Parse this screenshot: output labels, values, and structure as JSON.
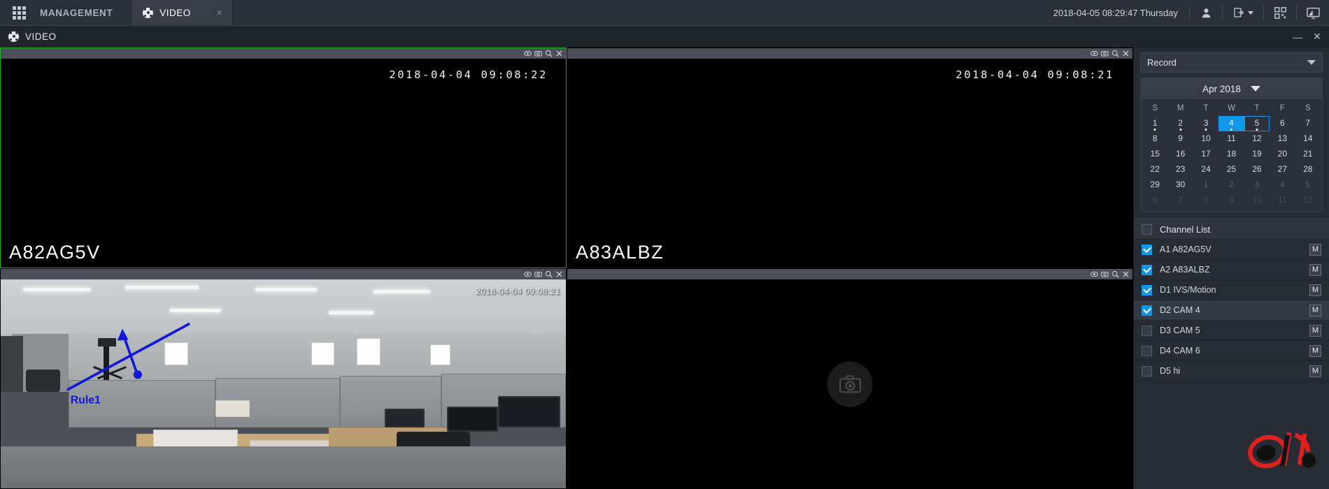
{
  "topbar": {
    "grid_icon": "app-grid-icon",
    "management_tab": "MANAGEMENT",
    "video_tab": "VIDEO",
    "video_tab_icon": "film-reel-icon",
    "close_icon": "×",
    "clock": "2018-04-05 08:29:47 Thursday",
    "icons": [
      {
        "name": "user-icon",
        "glyph": "👤"
      },
      {
        "name": "logout-icon",
        "glyph": "↪"
      },
      {
        "name": "qrcode-icon",
        "glyph": "░"
      },
      {
        "name": "display-icon",
        "glyph": "▣"
      }
    ]
  },
  "subbar": {
    "icon": "film-reel-icon",
    "title": "VIDEO",
    "minimize": "—",
    "close": "✕"
  },
  "video_panels": [
    {
      "index": "1",
      "selected": true,
      "timestamp": "2018-04-04 09:08:22",
      "label": "A82AG5V",
      "kind": "black",
      "controls": [
        "eye-icon",
        "camera-icon",
        "zoom-icon",
        "close-icon"
      ]
    },
    {
      "index": "2",
      "selected": false,
      "timestamp": "2018-04-04 09:08:21",
      "label": "A83ALBZ",
      "kind": "black",
      "controls": [
        "eye-icon",
        "camera-icon",
        "zoom-icon",
        "close-icon"
      ]
    },
    {
      "index": "3",
      "selected": false,
      "timestamp": "2018-04-04 09:08:21",
      "label": "",
      "kind": "office-scene",
      "ivs_rule_label": "Rule1",
      "controls": [
        "eye-icon",
        "camera-icon",
        "zoom-icon",
        "close-icon"
      ]
    },
    {
      "index": "4",
      "selected": false,
      "timestamp": "",
      "label": "",
      "kind": "empty",
      "placeholder_icon": "camera-icon",
      "controls": [
        "eye-icon",
        "camera-icon",
        "zoom-icon",
        "close-icon"
      ]
    }
  ],
  "right": {
    "record_dropdown": "Record",
    "calendar": {
      "month_label": "Apr 2018",
      "dow": [
        "S",
        "M",
        "T",
        "W",
        "T",
        "F",
        "S"
      ],
      "weeks": [
        [
          {
            "d": "1",
            "state": "normal",
            "dot": true
          },
          {
            "d": "2",
            "state": "normal",
            "dot": true
          },
          {
            "d": "3",
            "state": "normal",
            "dot": true
          },
          {
            "d": "4",
            "state": "selected",
            "dot": true
          },
          {
            "d": "5",
            "state": "today",
            "dot": true
          },
          {
            "d": "6",
            "state": "normal",
            "dot": false
          },
          {
            "d": "7",
            "state": "normal",
            "dot": false
          }
        ],
        [
          {
            "d": "8",
            "state": "normal",
            "dot": false
          },
          {
            "d": "9",
            "state": "normal",
            "dot": false
          },
          {
            "d": "10",
            "state": "normal",
            "dot": false
          },
          {
            "d": "11",
            "state": "normal",
            "dot": false
          },
          {
            "d": "12",
            "state": "normal",
            "dot": false
          },
          {
            "d": "13",
            "state": "normal",
            "dot": false
          },
          {
            "d": "14",
            "state": "normal",
            "dot": false
          }
        ],
        [
          {
            "d": "15",
            "state": "normal",
            "dot": false
          },
          {
            "d": "16",
            "state": "normal",
            "dot": false
          },
          {
            "d": "17",
            "state": "normal",
            "dot": false
          },
          {
            "d": "18",
            "state": "normal",
            "dot": false
          },
          {
            "d": "19",
            "state": "normal",
            "dot": false
          },
          {
            "d": "20",
            "state": "normal",
            "dot": false
          },
          {
            "d": "21",
            "state": "normal",
            "dot": false
          }
        ],
        [
          {
            "d": "22",
            "state": "normal",
            "dot": false
          },
          {
            "d": "23",
            "state": "normal",
            "dot": false
          },
          {
            "d": "24",
            "state": "normal",
            "dot": false
          },
          {
            "d": "25",
            "state": "normal",
            "dot": false
          },
          {
            "d": "26",
            "state": "normal",
            "dot": false
          },
          {
            "d": "27",
            "state": "normal",
            "dot": false
          },
          {
            "d": "28",
            "state": "normal",
            "dot": false
          }
        ],
        [
          {
            "d": "29",
            "state": "normal",
            "dot": false
          },
          {
            "d": "30",
            "state": "normal",
            "dot": false
          },
          {
            "d": "1",
            "state": "dim",
            "dot": false
          },
          {
            "d": "2",
            "state": "dim",
            "dot": false
          },
          {
            "d": "3",
            "state": "dim",
            "dot": false
          },
          {
            "d": "4",
            "state": "dim",
            "dot": false
          },
          {
            "d": "5",
            "state": "dim",
            "dot": false
          }
        ],
        [
          {
            "d": "6",
            "state": "vdim",
            "dot": false
          },
          {
            "d": "7",
            "state": "vdim",
            "dot": false
          },
          {
            "d": "8",
            "state": "vdim",
            "dot": false
          },
          {
            "d": "9",
            "state": "vdim",
            "dot": false
          },
          {
            "d": "10",
            "state": "vdim",
            "dot": false
          },
          {
            "d": "11",
            "state": "vdim",
            "dot": false
          },
          {
            "d": "12",
            "state": "vdim",
            "dot": false
          }
        ]
      ]
    },
    "channel_list": {
      "header": "Channel List",
      "header_checked": false,
      "mode_badge": "M",
      "items": [
        {
          "label": "A1 A82AG5V",
          "checked": true,
          "active": false
        },
        {
          "label": "A2 A83ALBZ",
          "checked": true,
          "active": false
        },
        {
          "label": "D1 IVS/Motion",
          "checked": true,
          "active": false
        },
        {
          "label": "D2 CAM 4",
          "checked": true,
          "active": true
        },
        {
          "label": "D3 CAM 5",
          "checked": false,
          "active": false
        },
        {
          "label": "D4 CAM 6",
          "checked": false,
          "active": false
        },
        {
          "label": "D5 hi",
          "checked": false,
          "active": false
        }
      ]
    }
  },
  "colors": {
    "accent_blue": "#1296e8",
    "selection_green": "#19b419",
    "panel_bg": "#272b33",
    "topbar_bg": "#2b2f38",
    "watermark_red": "#e8211e"
  }
}
